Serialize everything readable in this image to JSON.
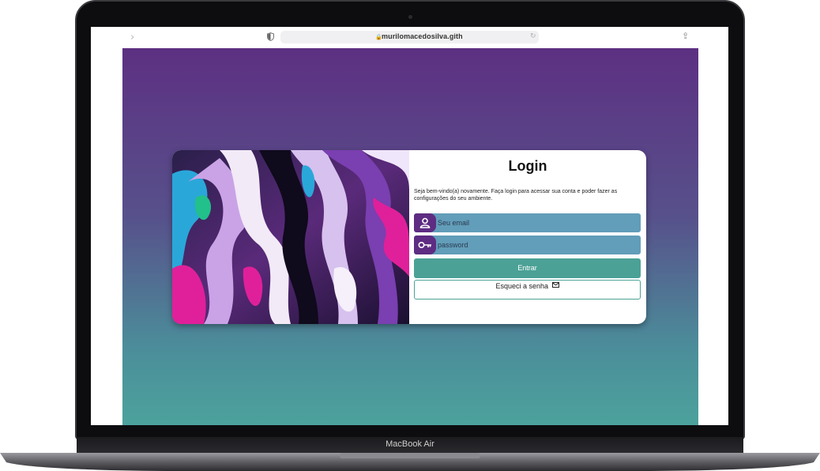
{
  "device": {
    "label": "MacBook Air"
  },
  "browser": {
    "url": "murilomacedosilva.gith"
  },
  "login": {
    "title": "Login",
    "intro": "Seja bem-vindo(a) novamente. Faça login para acessar sua conta e poder fazer as configurações do seu ambiente.",
    "email_placeholder": "Seu email",
    "password_placeholder": "password",
    "submit_label": "Entrar",
    "forgot_label": "Esqueci a senha"
  },
  "colors": {
    "gradient_top": "#5d3082",
    "gradient_bottom": "#4ca29c",
    "field_bg": "#629db9",
    "icon_bg": "#5e2c82",
    "accent": "#4ba196"
  },
  "icons": [
    "shield-icon",
    "lock-icon",
    "reload-icon",
    "share-icon",
    "user-icon",
    "key-icon",
    "mail-icon"
  ]
}
